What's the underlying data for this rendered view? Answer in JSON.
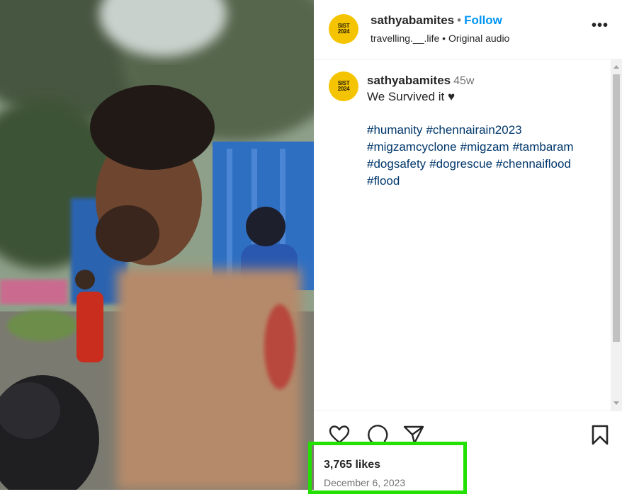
{
  "post": {
    "username": "sathyabamites",
    "follow_label": "Follow",
    "separator": "•",
    "audio_line": "travelling.__.life • Original audio",
    "avatar_text_top": "SIST",
    "avatar_text_bottom": "2024",
    "more_label": "•••"
  },
  "comment": {
    "username": "sathyabamites",
    "time": "45w",
    "caption": "We Survived it ♥",
    "hashtags": [
      "#humanity",
      "#chennairain2023",
      "#migzamcyclone",
      "#migzam",
      "#tambaram",
      "#dogsafety",
      "#dogrescue",
      "#chennaiflood",
      "#flood"
    ]
  },
  "stats": {
    "likes": "3,765 likes",
    "date": "December 6, 2023"
  },
  "colors": {
    "follow": "#0095f6",
    "hashtag": "#00376b",
    "highlight": "#22e000",
    "avatar": "#f5c400"
  },
  "icons": [
    "heart-icon",
    "comment-icon",
    "share-icon",
    "bookmark-icon",
    "more-icon"
  ]
}
